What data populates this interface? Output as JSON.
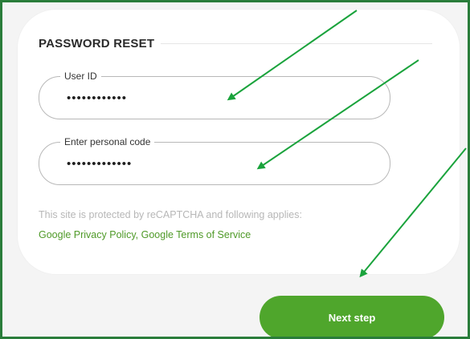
{
  "form": {
    "title": "PASSWORD RESET",
    "user_id": {
      "label": "User ID",
      "value": "••••••••••••"
    },
    "personal_code": {
      "label": "Enter personal code",
      "value": "•••••••••••••"
    },
    "notice": {
      "text": "This site is protected by reCAPTCHA and following applies:",
      "privacy_link": "Google Privacy Policy",
      "separator": ", ",
      "terms_link": "Google Terms of Service"
    },
    "next_button_label": "Next step"
  },
  "colors": {
    "accent_green": "#4fa62c",
    "frame_border": "#2a7d3a",
    "annotation_arrow": "#1aa33c",
    "link_green": "#4f9a28"
  },
  "annotations": {
    "arrow_count": 3,
    "arrow_icon": "arrow-icon"
  }
}
